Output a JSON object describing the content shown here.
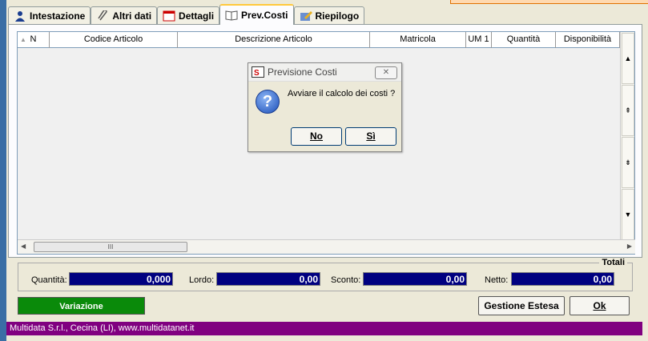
{
  "tabs": [
    {
      "label": "Intestazione",
      "icon": "person-icon"
    },
    {
      "label": "Altri dati",
      "icon": "paperclip-icon"
    },
    {
      "label": "Dettagli",
      "icon": "calendar-icon"
    },
    {
      "label": "Prev.Costi",
      "icon": "book-icon",
      "active": true
    },
    {
      "label": "Riepilogo",
      "icon": "pencil-icon"
    }
  ],
  "grid": {
    "columns": [
      "N",
      "Codice Articolo",
      "Descrizione Articolo",
      "Matricola",
      "UM 1",
      "Quantità",
      "Disponibilità"
    ],
    "rows": [],
    "hscroll_thumb": "III"
  },
  "dialog": {
    "title": "Previsione Costi",
    "close": "✕",
    "message": "Avviare il calcolo dei costi ?",
    "no_label": "No",
    "yes_label": "Sì"
  },
  "totals": {
    "legend": "Totali",
    "quantita_label": "Quantità:",
    "quantita_value": "0,000",
    "lordo_label": "Lordo:",
    "lordo_value": "0,00",
    "sconto_label": "Sconto:",
    "sconto_value": "0,00",
    "netto_label": "Netto:",
    "netto_value": "0,00"
  },
  "actions": {
    "variazione_label": "Variazione",
    "gestione_label": "Gestione Estesa",
    "ok_label": "Ok"
  },
  "status": {
    "text": "Multidata S.r.l., Cecina (LI), www.multidatanet.it"
  },
  "colors": {
    "status_bar": "#800080",
    "total_field": "#000080",
    "variazione": "#0a8a0a"
  }
}
